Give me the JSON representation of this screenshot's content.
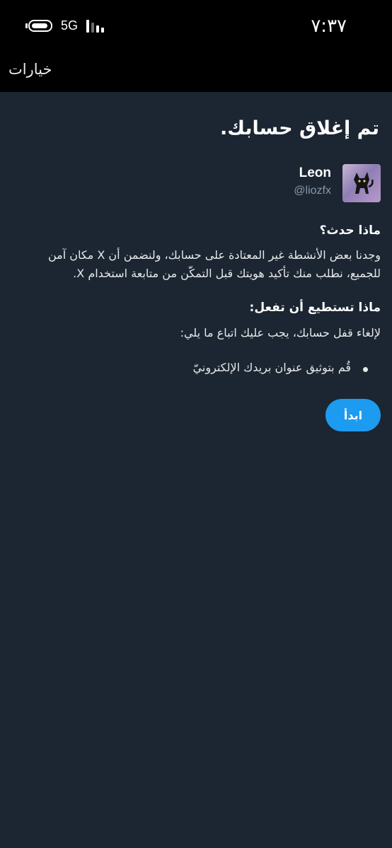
{
  "status_bar": {
    "network": "5G",
    "time": "٧:٣٧"
  },
  "app_bar": {
    "options_label": "خيارات"
  },
  "main": {
    "title": "تم إغلاق حسابك.",
    "user": {
      "name": "Leon",
      "handle": "@liozfx"
    },
    "what_happened": {
      "heading": "ماذا حدث؟",
      "body": "وجدنا بعض الأنشطة غير المعتادة على حسابك، ولنضمن أن X مكان آمن للجميع، نطلب منك تأكيد هويتك قبل التمكّن من متابعة استخدام X."
    },
    "what_to_do": {
      "heading": "ماذا تستطيع أن تفعل:",
      "body": "لإلغاء قفل حسابك، يجب عليك اتباع ما يلي:",
      "steps": [
        "قُم بتوثيق عنوان بريدك الإلكترونيّ"
      ]
    },
    "start_button": "ابدأ"
  },
  "colors": {
    "background": "#1b2632",
    "accent": "#1d9bf0",
    "secondary_text": "#8b98a5"
  }
}
